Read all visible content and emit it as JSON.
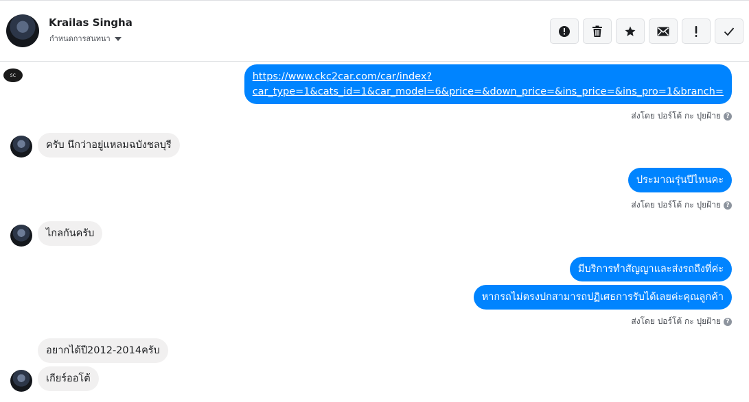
{
  "header": {
    "contact_name": "Krailas Singha",
    "assign_label": "กำหนดการสนทนา",
    "actions": [
      {
        "name": "mark-spam-button",
        "icon": "alert-circle-icon"
      },
      {
        "name": "delete-button",
        "icon": "trash-icon"
      },
      {
        "name": "star-button",
        "icon": "star-icon"
      },
      {
        "name": "mark-unread-button",
        "icon": "envelope-icon"
      },
      {
        "name": "follow-up-button",
        "icon": "exclamation-icon"
      },
      {
        "name": "mark-done-button",
        "icon": "check-icon"
      }
    ]
  },
  "page_logo_text": "SC",
  "messages": [
    {
      "id": "m1",
      "direction": "outgoing",
      "text": "https://www.ckc2car.com/car/index?car_type=1&cats_id=1&car_model=6&price=&down_price=&ins_price=&ins_pro=1&branch=",
      "line1": "https://www.ckc2car.com/car/index?",
      "line2": "car_type=1&cats_id=1&car_model=6&price=&down_price=&ins_price=&ins_pro=1&branch="
    },
    {
      "id": "m2",
      "direction": "incoming",
      "text": "ครับ นึกว่าอยู่แหลมฉบังชลบุรี"
    },
    {
      "id": "m3",
      "direction": "outgoing",
      "text": "ประมาณรุ่นปีไหนคะ"
    },
    {
      "id": "m4",
      "direction": "incoming",
      "text": "ไกลกันครับ"
    },
    {
      "id": "m5",
      "direction": "outgoing",
      "text": "มีบริการทำสัญญาและส่งรถถึงที่ค่ะ"
    },
    {
      "id": "m6",
      "direction": "outgoing",
      "text": "หากรถไม่ตรงปกสามารถปฏิเศธการรับได้เลยค่ะคุณลูกค้า"
    },
    {
      "id": "m7",
      "direction": "incoming",
      "text": "อยากได้ปี2012-2014ครับ"
    },
    {
      "id": "m8",
      "direction": "incoming",
      "text": "เกียร์ออโต้"
    }
  ],
  "sent_by_label": "ส่งโดย ปอร์โต้ กะ ปุยฝ้าย",
  "help_glyph": "?"
}
